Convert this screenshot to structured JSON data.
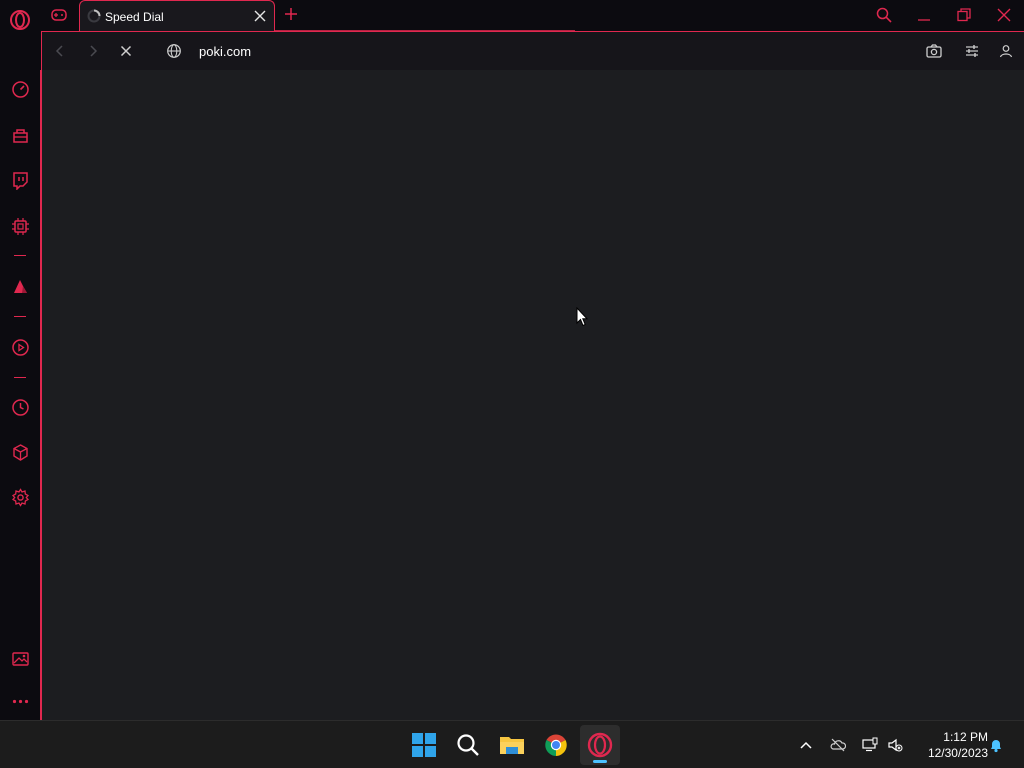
{
  "browser": {
    "name": "Opera GX",
    "accent": "#e0284f",
    "tab": {
      "title": "Speed Dial",
      "loading": true
    },
    "address": {
      "url": "poki.com",
      "state": "loading"
    },
    "sidebar_items": [
      "speed-dial",
      "shopping-corner",
      "twitch",
      "gx-control",
      "arcade",
      "video-player",
      "history",
      "extensions",
      "settings",
      "screenshot",
      "more"
    ]
  },
  "taskbar": {
    "apps": [
      "windows-start",
      "search",
      "file-explorer",
      "chrome",
      "opera-gx"
    ],
    "active_app": "opera-gx",
    "clock": {
      "time": "1:12 PM",
      "date": "12/30/2023"
    }
  }
}
